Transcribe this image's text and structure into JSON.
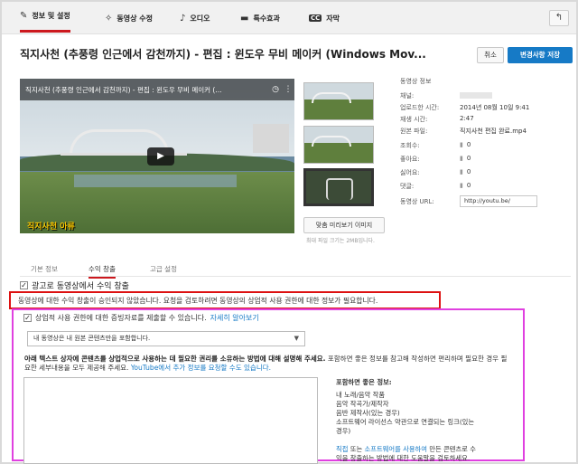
{
  "tabs": [
    {
      "label": "정보 및 설정",
      "icon": "pencil-icon",
      "glyph": "✎"
    },
    {
      "label": "동영상 수정",
      "icon": "wand-icon",
      "glyph": "✧"
    },
    {
      "label": "오디오",
      "icon": "music-note-icon",
      "glyph": "♪"
    },
    {
      "label": "특수효과",
      "icon": "chat-bubble-icon",
      "glyph": "▬"
    },
    {
      "label": "자막",
      "icon": "cc-icon",
      "glyph": "CC"
    }
  ],
  "back_glyph": "↰",
  "title": "직지사천 (추풍령 인근에서 감천까지) - 편집 : 윈도우 무비 메이커 (Windows Mov...",
  "buttons": {
    "cancel": "취소",
    "save": "변경사항 저장",
    "custom_thumb": "맞춤 미리보기 이미지"
  },
  "player": {
    "title": "직지사천 (추풍령 인근에서 감천까지) - 편집 : 윈도우 무비 메이커 (...",
    "clock_glyph": "◷",
    "more_glyph": "⋮",
    "play_glyph": "▶",
    "watermark": "직지사천 아류"
  },
  "thumb_hint": "최대 파일 크기는 2MB입니다.",
  "info": {
    "header": "동영상 정보",
    "channel_label": "채널:",
    "channel_value": "",
    "upload_label": "업로드한 시간:",
    "upload_value": "2014년 08월 10일 9:41",
    "duration_label": "재생 시간:",
    "duration_value": "2:47",
    "file_label": "원본 파일:",
    "file_value": "직지사천 편집 완료.mp4",
    "views_label": "조회수:",
    "views_value": "0",
    "likes_label": "좋아요:",
    "likes_value": "0",
    "dislikes_label": "싫어요:",
    "dislikes_value": "0",
    "comments_label": "댓글:",
    "comments_value": "0",
    "url_label": "동영상 URL:",
    "url_value": "http://youtu.be/",
    "stat_glyph": "▮"
  },
  "subtabs": [
    "기본 정보",
    "수익 창출",
    "고급 설정"
  ],
  "monetize_check": {
    "checked": "✓",
    "label": "광고로 동영상에서 수익 창출"
  },
  "notice": "동영상에 대한 수익 창출이 승인되지 않았습니다. 요청을 검토하려면 동영상의 상업적 사용 권한에 대한 정보가 필요합니다.",
  "rights_check": {
    "checked": "✓",
    "label": "상업적 사용 권한에 대한 증빙자료를 제출할 수 있습니다.",
    "link": "자세히 알아보기"
  },
  "select": {
    "value": "내 동영상은 내 원본 콘텐츠만을 포함합니다.",
    "caret": "▼"
  },
  "instructions": {
    "bold": "아래 텍스트 상자에 콘텐츠를 상업적으로 사용하는 데 필요한 권리를 소유하는 방법에 대해 설명해 주세요.",
    "normal": " 포함하면 좋은 정보를 참고해 작성하면 편리하며 필요한 경우 필요한 세부내용을 모두 제공해 주세요. ",
    "blue": "YouTube에서 추가 정보를 요청할 수도 있습니다."
  },
  "tips": {
    "title": "포함하면 좋은 정보:",
    "lines": [
      "내 노래/음악 작품",
      "음악 작곡가/제작자",
      "음반 제작사(있는 경우)",
      "소프트웨어 라이선스 약관으로 연결되는 링크(있는",
      "경우)"
    ],
    "link_prefix": "직접",
    "link_mid1": " 또는 ",
    "link_software": "소프트웨어를 사용하여",
    "link_rest": " 만든 콘텐츠로 수",
    "last": "익을 창출하는 방법에 대한 도움말을 검토하세요."
  }
}
